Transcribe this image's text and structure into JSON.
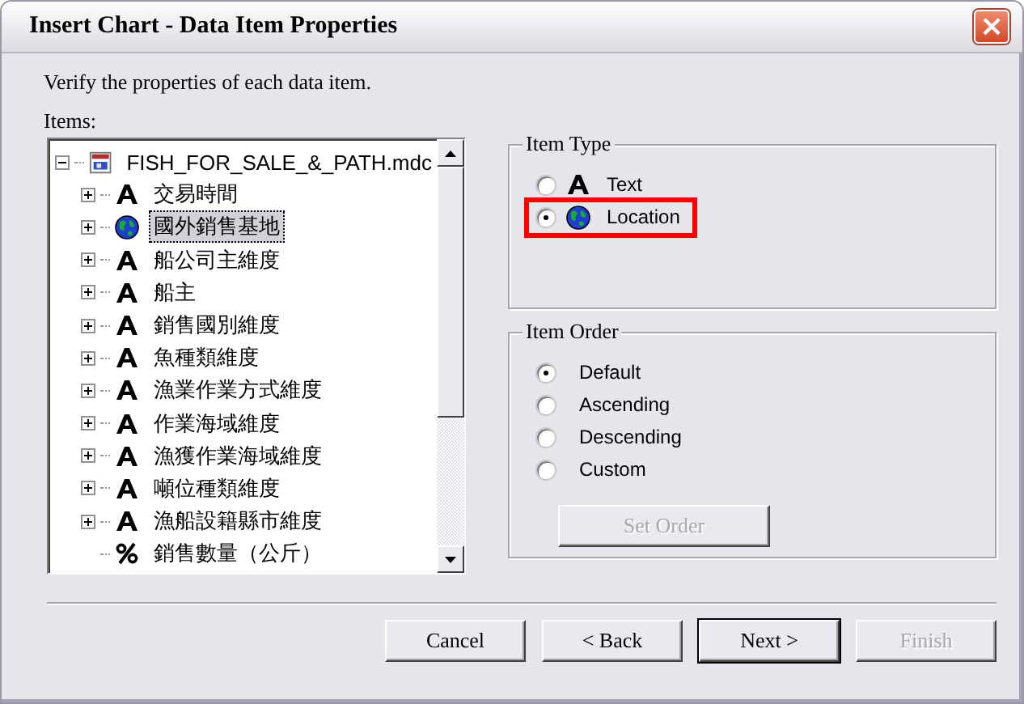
{
  "window": {
    "title": "Insert Chart - Data Item Properties",
    "close": "×"
  },
  "instruction": "Verify the properties of each data item.",
  "items_label": "Items:",
  "tree": {
    "label": "FISH_FOR_SALE_&_PATH.mdc",
    "kind": "file",
    "expanded": true,
    "selected": false,
    "children": [
      {
        "label": "交易時間",
        "kind": "text",
        "expanded": false,
        "selected": false
      },
      {
        "label": "國外銷售基地",
        "kind": "location",
        "expanded": false,
        "selected": true
      },
      {
        "label": "船公司主維度",
        "kind": "text",
        "expanded": false,
        "selected": false
      },
      {
        "label": "船主",
        "kind": "text",
        "expanded": false,
        "selected": false
      },
      {
        "label": "銷售國別維度",
        "kind": "text",
        "expanded": false,
        "selected": false
      },
      {
        "label": "魚種類維度",
        "kind": "text",
        "expanded": false,
        "selected": false
      },
      {
        "label": "漁業作業方式維度",
        "kind": "text",
        "expanded": false,
        "selected": false
      },
      {
        "label": "作業海域維度",
        "kind": "text",
        "expanded": false,
        "selected": false
      },
      {
        "label": "漁獲作業海域維度",
        "kind": "text",
        "expanded": false,
        "selected": false
      },
      {
        "label": "噸位種類維度",
        "kind": "text",
        "expanded": false,
        "selected": false
      },
      {
        "label": "漁船設籍縣市維度",
        "kind": "text",
        "expanded": false,
        "selected": false
      },
      {
        "label": "銷售數量（公斤）",
        "kind": "measure",
        "selected": false
      }
    ]
  },
  "item_type": {
    "title": "Item Type",
    "options": [
      {
        "label": "Text",
        "kind": "text",
        "selected": false,
        "highlighted": false
      },
      {
        "label": "Location",
        "kind": "location",
        "selected": true,
        "highlighted": true
      }
    ]
  },
  "item_order": {
    "title": "Item Order",
    "options": [
      {
        "label": "Default",
        "selected": true
      },
      {
        "label": "Ascending",
        "selected": false
      },
      {
        "label": "Descending",
        "selected": false
      },
      {
        "label": "Custom",
        "selected": false
      }
    ],
    "set_order": {
      "label": "Set Order",
      "disabled": true
    }
  },
  "buttons": [
    {
      "label": "Cancel",
      "disabled": false,
      "default": false
    },
    {
      "label": "< Back",
      "disabled": false,
      "default": false
    },
    {
      "label": "Next >",
      "disabled": false,
      "default": true
    },
    {
      "label": "Finish",
      "disabled": true,
      "default": false
    }
  ]
}
